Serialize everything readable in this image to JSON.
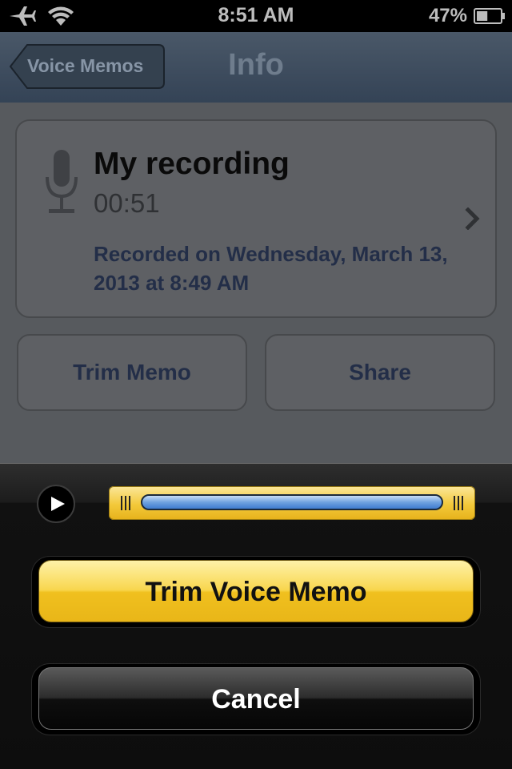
{
  "status_bar": {
    "time": "8:51 AM",
    "battery_percent": "47%",
    "battery_level": 0.47,
    "icons": [
      "airplane-icon",
      "wifi-icon",
      "battery-icon"
    ]
  },
  "nav": {
    "back_label": "Voice Memos",
    "title": "Info"
  },
  "recording": {
    "title": "My recording",
    "duration": "00:51",
    "recorded_on": "Recorded on Wednesday, March 13, 2013 at 8:49 AM"
  },
  "actions": {
    "trim_label": "Trim Memo",
    "share_label": "Share"
  },
  "sheet": {
    "trim_button_label": "Trim Voice Memo",
    "cancel_button_label": "Cancel"
  },
  "colors": {
    "accent_yellow": "#f0c01f",
    "nav_blue": "#344356",
    "link_text": "#232e48"
  }
}
